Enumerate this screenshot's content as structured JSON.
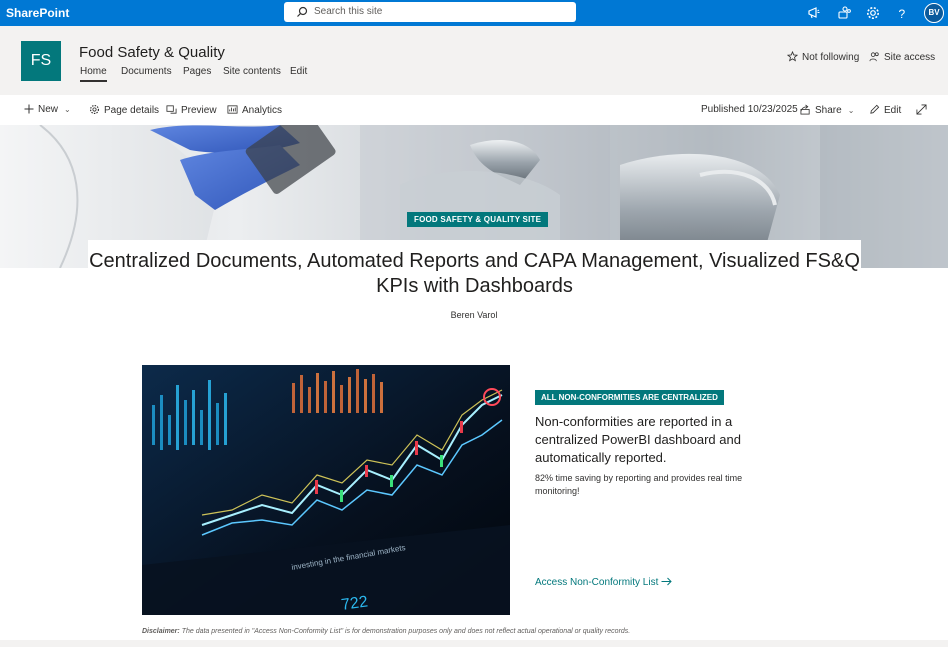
{
  "suitebar": {
    "brand": "SharePoint",
    "search_placeholder": "Search this site",
    "avatar_initials": "BV"
  },
  "site": {
    "logo_initials": "FS",
    "title": "Food Safety & Quality",
    "nav": [
      "Home",
      "Documents",
      "Pages",
      "Site contents",
      "Edit"
    ],
    "follow_label": "Not following",
    "access_label": "Site access"
  },
  "commandbar": {
    "new_label": "New",
    "page_details_label": "Page details",
    "preview_label": "Preview",
    "analytics_label": "Analytics",
    "published_label": "Published 10/23/2025",
    "share_label": "Share",
    "edit_label": "Edit"
  },
  "hero": {
    "tag": "FOOD SAFETY & QUALITY SITE",
    "title": "Centralized Documents, Automated Reports and CAPA Management, Visualized FS&Q KPIs with Dashboards",
    "author": "Beren Varol"
  },
  "section": {
    "tag": "ALL NON-CONFORMITIES ARE CENTRALIZED",
    "heading": "Non-conformities are reported in a centralized PowerBI dashboard and automatically reported.",
    "body": "82% time saving by reporting and provides real time monitoring!",
    "link": "Access Non-Conformity List",
    "image_caption_text": "722",
    "disclaimer_label": "Disclaimer:",
    "disclaimer_text": " The data presented in \"Access Non-Conformity List\" is for demonstration purposes only and does not reflect actual operational or quality records."
  },
  "colors": {
    "suitebar": "#0078d4",
    "theme": "#03787c",
    "header_bg": "#f3f2f1"
  }
}
